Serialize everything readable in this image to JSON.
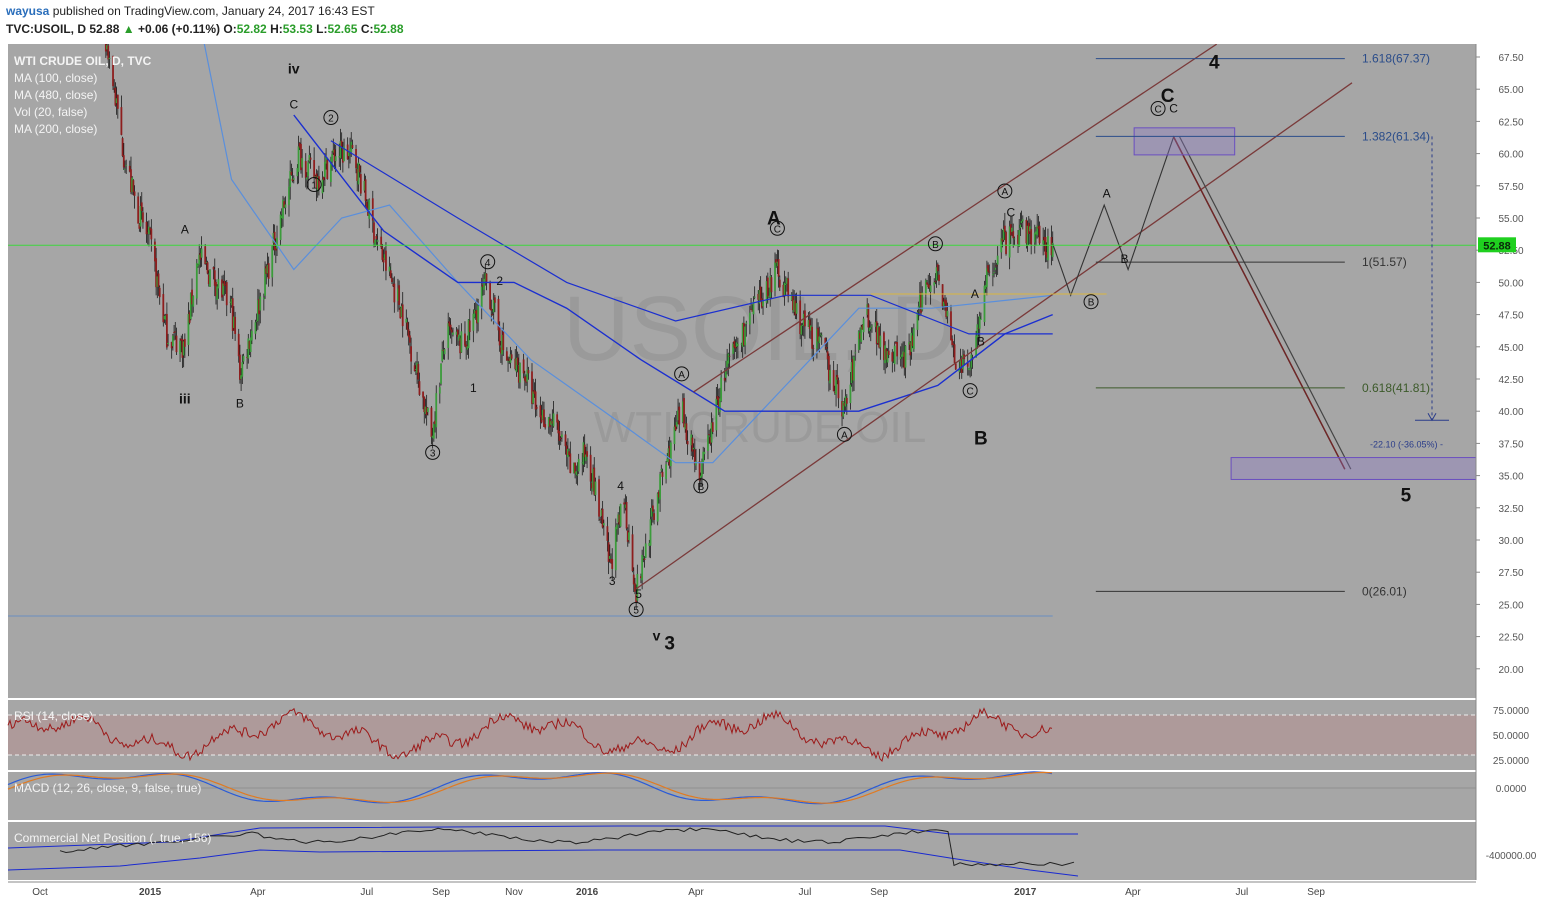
{
  "header": {
    "user": "wayusa",
    "published": "published on TradingView.com, January 24, 2017 16:43 EST",
    "symbol": "TVC:USOIL, D",
    "last": "52.88",
    "change": "+0.06 (+0.11%)",
    "o_label": "O:",
    "o_val": "52.82",
    "h_label": "H:",
    "h_val": "53.53",
    "l_label": "L:",
    "l_val": "52.65",
    "c_label": "C:",
    "c_val": "52.88"
  },
  "legend": [
    "WTI CRUDE OIL, D, TVC",
    "MA (100, close)",
    "MA (480, close)",
    "Vol (20, false)",
    "MA (200, close)"
  ],
  "watermark": {
    "symbol": "USOIL, D",
    "name": "WTI CRUDE OIL"
  },
  "colors": {
    "background": "#a6a6a6",
    "up_candle": "#3b9c3b",
    "down_candle": "#8e1e1e",
    "ma_fast": "#5a8fdc",
    "ma_slow": "#1b2fd0",
    "channel": "#7a3a3a",
    "fib": "#333333",
    "rsi": "#9c1a1a",
    "macd": "#2a5bd7",
    "signal": "#e07a22",
    "last_price": "#1fd01f"
  },
  "chart_data": [
    {
      "type": "candlestick",
      "y_ticks": [
        "67.50",
        "65.00",
        "62.50",
        "60.00",
        "57.50",
        "55.00",
        "52.50",
        "50.00",
        "47.50",
        "45.00",
        "42.50",
        "40.00",
        "37.50",
        "35.00",
        "32.50",
        "30.00",
        "27.50",
        "25.00",
        "22.50",
        "20.00"
      ],
      "ylim": [
        18.5,
        68.5
      ],
      "x_ticks": [
        "Oct",
        "2015",
        "Apr",
        "Jul",
        "Sep",
        "Nov",
        "2016",
        "Apr",
        "Jul",
        "Sep",
        "2017",
        "Apr",
        "Jul",
        "Sep"
      ],
      "last_price": 52.88,
      "close_path": [
        [
          "2014-09-25",
          77
        ],
        [
          "2014-11-10",
          73
        ],
        [
          "2014-11-27",
          68
        ],
        [
          "2014-12-10",
          60
        ],
        [
          "2014-12-20",
          56
        ],
        [
          "2015-01-01",
          53
        ],
        [
          "2015-01-15",
          46
        ],
        [
          "2015-01-30",
          45
        ],
        [
          "2015-02-10",
          52
        ],
        [
          "2015-02-25",
          50
        ],
        [
          "2015-03-10",
          48
        ],
        [
          "2015-03-17",
          43
        ],
        [
          "2015-04-01",
          48
        ],
        [
          "2015-04-20",
          55
        ],
        [
          "2015-05-05",
          60
        ],
        [
          "2015-05-20",
          58
        ],
        [
          "2015-06-05",
          60
        ],
        [
          "2015-06-20",
          60
        ],
        [
          "2015-07-10",
          53
        ],
        [
          "2015-07-30",
          48
        ],
        [
          "2015-08-12",
          43
        ],
        [
          "2015-08-24",
          38
        ],
        [
          "2015-09-05",
          46
        ],
        [
          "2015-09-20",
          45
        ],
        [
          "2015-10-09",
          50
        ],
        [
          "2015-10-25",
          44
        ],
        [
          "2015-11-10",
          43
        ],
        [
          "2015-11-20",
          40
        ],
        [
          "2015-12-05",
          39
        ],
        [
          "2015-12-20",
          35
        ],
        [
          "2016-01-01",
          37
        ],
        [
          "2016-01-20",
          28
        ],
        [
          "2016-02-01",
          33
        ],
        [
          "2016-02-11",
          26
        ],
        [
          "2016-03-01",
          34
        ],
        [
          "2016-03-20",
          40
        ],
        [
          "2016-04-05",
          35
        ],
        [
          "2016-04-25",
          43
        ],
        [
          "2016-05-15",
          47
        ],
        [
          "2016-06-08",
          51
        ],
        [
          "2016-06-27",
          47
        ],
        [
          "2016-07-15",
          45
        ],
        [
          "2016-08-03",
          40
        ],
        [
          "2016-08-20",
          48
        ],
        [
          "2016-09-05",
          45
        ],
        [
          "2016-09-25",
          44
        ],
        [
          "2016-10-10",
          50
        ],
        [
          "2016-10-20",
          51
        ],
        [
          "2016-11-03",
          44
        ],
        [
          "2016-11-14",
          43
        ],
        [
          "2016-11-30",
          50
        ],
        [
          "2016-12-12",
          53
        ],
        [
          "2017-01-03",
          54
        ],
        [
          "2017-01-20",
          52.9
        ]
      ],
      "ma_fast": [
        [
          "2015-01-15",
          83
        ],
        [
          "2015-03-10",
          58
        ],
        [
          "2015-05-01",
          51
        ],
        [
          "2015-06-10",
          55
        ],
        [
          "2015-07-20",
          56
        ],
        [
          "2015-09-15",
          50
        ],
        [
          "2015-11-15",
          44
        ],
        [
          "2016-01-15",
          40
        ],
        [
          "2016-03-15",
          36
        ],
        [
          "2016-04-15",
          36
        ],
        [
          "2016-06-15",
          42
        ],
        [
          "2016-08-15",
          48
        ],
        [
          "2016-10-15",
          48
        ],
        [
          "2017-01-24",
          49
        ]
      ],
      "ma_slow": [
        [
          "2015-05-01",
          63
        ],
        [
          "2015-07-15",
          54
        ],
        [
          "2015-09-15",
          50
        ],
        [
          "2015-11-01",
          50
        ],
        [
          "2015-12-15",
          48
        ],
        [
          "2016-02-15",
          44
        ],
        [
          "2016-04-25",
          40
        ],
        [
          "2016-06-15",
          40
        ],
        [
          "2016-08-15",
          40
        ],
        [
          "2016-10-20",
          42
        ],
        [
          "2016-12-15",
          46
        ],
        [
          "2017-01-24",
          47.5
        ]
      ],
      "ma_200": [
        [
          "2015-06-01",
          61
        ],
        [
          "2015-09-15",
          55
        ],
        [
          "2015-12-15",
          50
        ],
        [
          "2016-03-15",
          47
        ],
        [
          "2016-06-15",
          49
        ],
        [
          "2016-08-25",
          49
        ],
        [
          "2016-11-15",
          46
        ],
        [
          "2017-01-24",
          46
        ]
      ],
      "channel": {
        "lower": [
          [
            "2016-02-11",
            26.2
          ],
          [
            "2017-10-01",
            65.5
          ]
        ],
        "upper": [
          [
            "2016-03-30",
            41.5
          ],
          [
            "2017-06-10",
            68.5
          ]
        ]
      },
      "projection": [
        [
          "2017-01-24",
          53
        ],
        [
          "2017-02-08",
          49
        ],
        [
          "2017-03-08",
          56
        ],
        [
          "2017-03-28",
          51
        ],
        [
          "2017-05-05",
          61.3
        ],
        [
          "2017-09-25",
          35.5
        ]
      ],
      "fib_levels": [
        {
          "label": "1.618(67.37)",
          "value": 67.37
        },
        {
          "label": "1.382(61.34)",
          "value": 61.34
        },
        {
          "label": "1(51.57)",
          "value": 51.57
        },
        {
          "label": "0.618(41.81)",
          "value": 41.81
        },
        {
          "label": "0(26.01)",
          "value": 26.01
        }
      ],
      "measure_label": "-22.10 (-36.05%) -",
      "wave_labels": [
        {
          "text": "iv",
          "date": "2015-05-01",
          "price": 66.2,
          "bold": true
        },
        {
          "text": "C",
          "date": "2015-05-01",
          "price": 63.5
        },
        {
          "text": "iii",
          "date": "2015-01-30",
          "price": 40.6,
          "bold": true
        },
        {
          "text": "A",
          "date": "2015-01-30",
          "price": 53.8
        },
        {
          "text": "B",
          "date": "2015-03-17",
          "price": 40.3
        },
        {
          "text": "1",
          "date": "2015-09-28",
          "price": 41.5
        },
        {
          "text": "2",
          "date": "2015-10-20",
          "price": 49.8
        },
        {
          "text": "3",
          "date": "2016-01-22",
          "price": 26.5
        },
        {
          "text": "4",
          "date": "2016-01-29",
          "price": 33.9
        },
        {
          "text": "5",
          "date": "2016-02-13",
          "price": 25.5
        },
        {
          "text": "v",
          "date": "2016-02-28",
          "price": 22.2,
          "bold": true
        },
        {
          "text": "3",
          "date": "2016-03-10",
          "price": 21.5,
          "big": true
        },
        {
          "text": "A",
          "date": "2016-06-05",
          "price": 54.5,
          "big": true
        },
        {
          "text": "B",
          "date": "2016-11-25",
          "price": 37.4,
          "big": true
        },
        {
          "text": "C",
          "date": "2016-12-20",
          "price": 55.1
        },
        {
          "text": "A",
          "date": "2016-11-20",
          "price": 48.8
        },
        {
          "text": "B",
          "date": "2016-11-25",
          "price": 45.1
        },
        {
          "text": "A",
          "date": "2017-03-10",
          "price": 56.6
        },
        {
          "text": "B",
          "date": "2017-03-25",
          "price": 51.5
        },
        {
          "text": "C",
          "date": "2017-05-05",
          "price": 63.2
        },
        {
          "text": "C",
          "date": "2017-04-30",
          "price": 64.0,
          "big": true
        },
        {
          "text": "4",
          "date": "2017-06-08",
          "price": 66.6,
          "big": true
        },
        {
          "text": "5",
          "date": "2017-11-15",
          "price": 33.0,
          "big": true
        }
      ],
      "circled_labels": [
        {
          "text": "1",
          "date": "2015-05-18",
          "price": 57.6
        },
        {
          "text": "2",
          "date": "2015-06-01",
          "price": 62.8
        },
        {
          "text": "3",
          "date": "2015-08-25",
          "price": 36.8
        },
        {
          "text": "4",
          "date": "2015-10-10",
          "price": 51.6
        },
        {
          "text": "5",
          "date": "2016-02-11",
          "price": 24.6
        },
        {
          "text": "A",
          "date": "2016-03-20",
          "price": 42.9
        },
        {
          "text": "B",
          "date": "2016-04-05",
          "price": 34.2
        },
        {
          "text": "C",
          "date": "2016-06-08",
          "price": 54.2
        },
        {
          "text": "A",
          "date": "2016-08-03",
          "price": 38.2
        },
        {
          "text": "B",
          "date": "2016-10-18",
          "price": 53.0
        },
        {
          "text": "C",
          "date": "2016-11-16",
          "price": 41.6
        },
        {
          "text": "A",
          "date": "2016-12-15",
          "price": 57.1
        },
        {
          "text": "B",
          "date": "2017-02-25",
          "price": 48.5
        },
        {
          "text": "C",
          "date": "2017-04-22",
          "price": 63.5
        }
      ]
    },
    {
      "type": "line",
      "title": "RSI (14, close)",
      "y_ticks": [
        "75.0000",
        "50.0000",
        "25.0000"
      ],
      "levels": [
        70,
        30
      ],
      "ylim": [
        15,
        85
      ]
    },
    {
      "type": "line",
      "title": "MACD (12, 26, close, 9, false, true)",
      "y_ticks": [
        "0.0000"
      ],
      "series": [
        {
          "values": []
        },
        {
          "values": []
        }
      ]
    },
    {
      "type": "line",
      "title": "Commercial Net Position (, true, 156)",
      "y_ticks": [
        "-400000.00"
      ]
    }
  ]
}
